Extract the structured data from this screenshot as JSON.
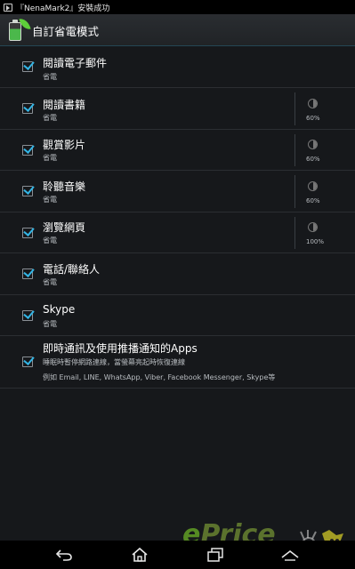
{
  "status_bar": {
    "notification_text": "『NenaMark2』安裝成功"
  },
  "action_bar": {
    "title": "自訂省電模式",
    "app_icon": "battery-leaf-icon"
  },
  "list": {
    "items": [
      {
        "title": "閱讀電子郵件",
        "subtitle": "省電",
        "checked": true
      },
      {
        "title": "閱讀書籍",
        "subtitle": "省電",
        "checked": true,
        "brightness": "60%"
      },
      {
        "title": "觀賞影片",
        "subtitle": "省電",
        "checked": true,
        "brightness": "60%"
      },
      {
        "title": "聆聽音樂",
        "subtitle": "省電",
        "checked": true,
        "brightness": "60%"
      },
      {
        "title": "瀏覽網頁",
        "subtitle": "省電",
        "checked": true,
        "brightness": "100%"
      },
      {
        "title": "電話/聯絡人",
        "subtitle": "省電",
        "checked": true
      },
      {
        "title": "Skype",
        "subtitle": "省電",
        "checked": true
      },
      {
        "title": "即時通訊及使用推播通知的Apps",
        "subtitle": "睡眠時暫停網路連線，當螢幕亮起時恢復連線",
        "subtitle2": "例如 Email, LINE, WhatsApp, Viber, Facebook Messenger, Skype等",
        "checked": true
      }
    ]
  },
  "nav_bar": {
    "back": "back-icon",
    "home": "home-icon",
    "recent": "recent-apps-icon",
    "up": "chevron-up-icon"
  },
  "watermark": {
    "e": "e",
    "rest": "Price"
  },
  "colors": {
    "accent": "#33b5e5",
    "background": "#16181b"
  }
}
